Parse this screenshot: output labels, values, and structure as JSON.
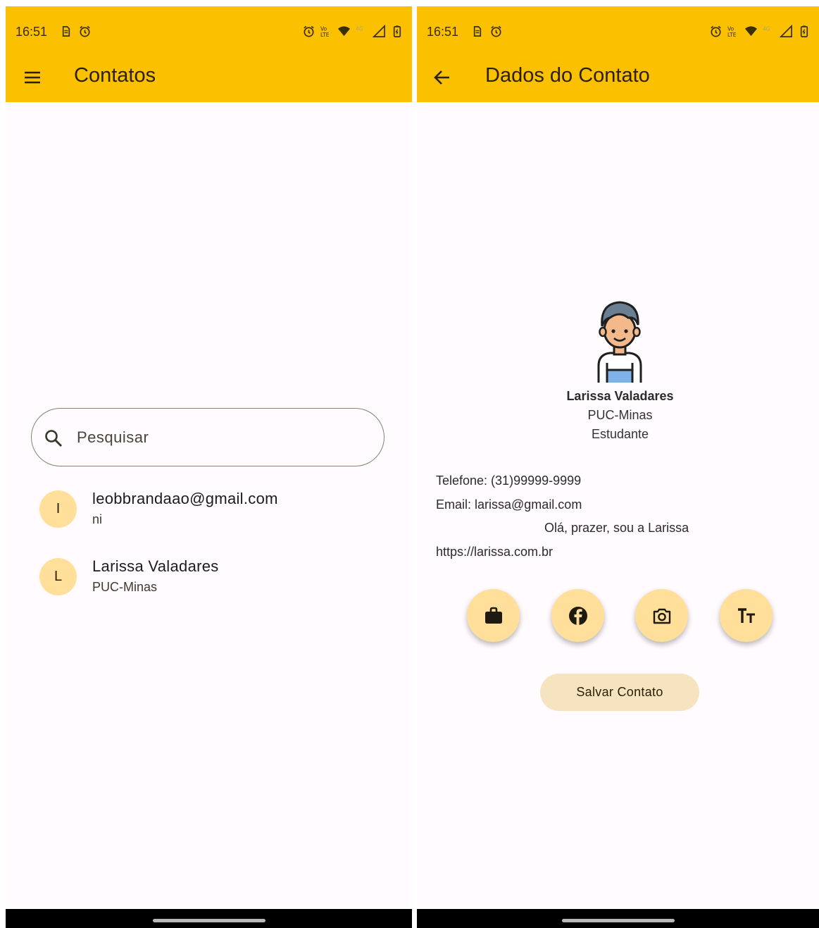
{
  "status_bar": {
    "time": "16:51"
  },
  "list_screen": {
    "title": "Contatos",
    "search": {
      "placeholder": "Pesquisar",
      "value": ""
    },
    "contacts": [
      {
        "initial": "I",
        "title": "leobbrandaao@gmail.com",
        "subtitle": "ni"
      },
      {
        "initial": "L",
        "title": "Larissa Valadares",
        "subtitle": "PUC-Minas"
      }
    ]
  },
  "detail_screen": {
    "title": "Dados do Contato",
    "name": "Larissa Valadares",
    "organization": "PUC-Minas",
    "role": "Estudante",
    "phone": "Telefone: (31)99999-9999",
    "email": "Email: larissa@gmail.com",
    "bio": "Olá, prazer, sou a Larissa",
    "website": "https://larissa.com.br",
    "action_buttons": [
      "briefcase-icon",
      "facebook-icon",
      "camera-icon",
      "text-size-icon"
    ],
    "save_label": "Salvar Contato"
  },
  "colors": {
    "accent": "#FBC000",
    "chip": "#FFDF99",
    "save_button": "#F6E3BF",
    "background": "#FFFBFE"
  }
}
